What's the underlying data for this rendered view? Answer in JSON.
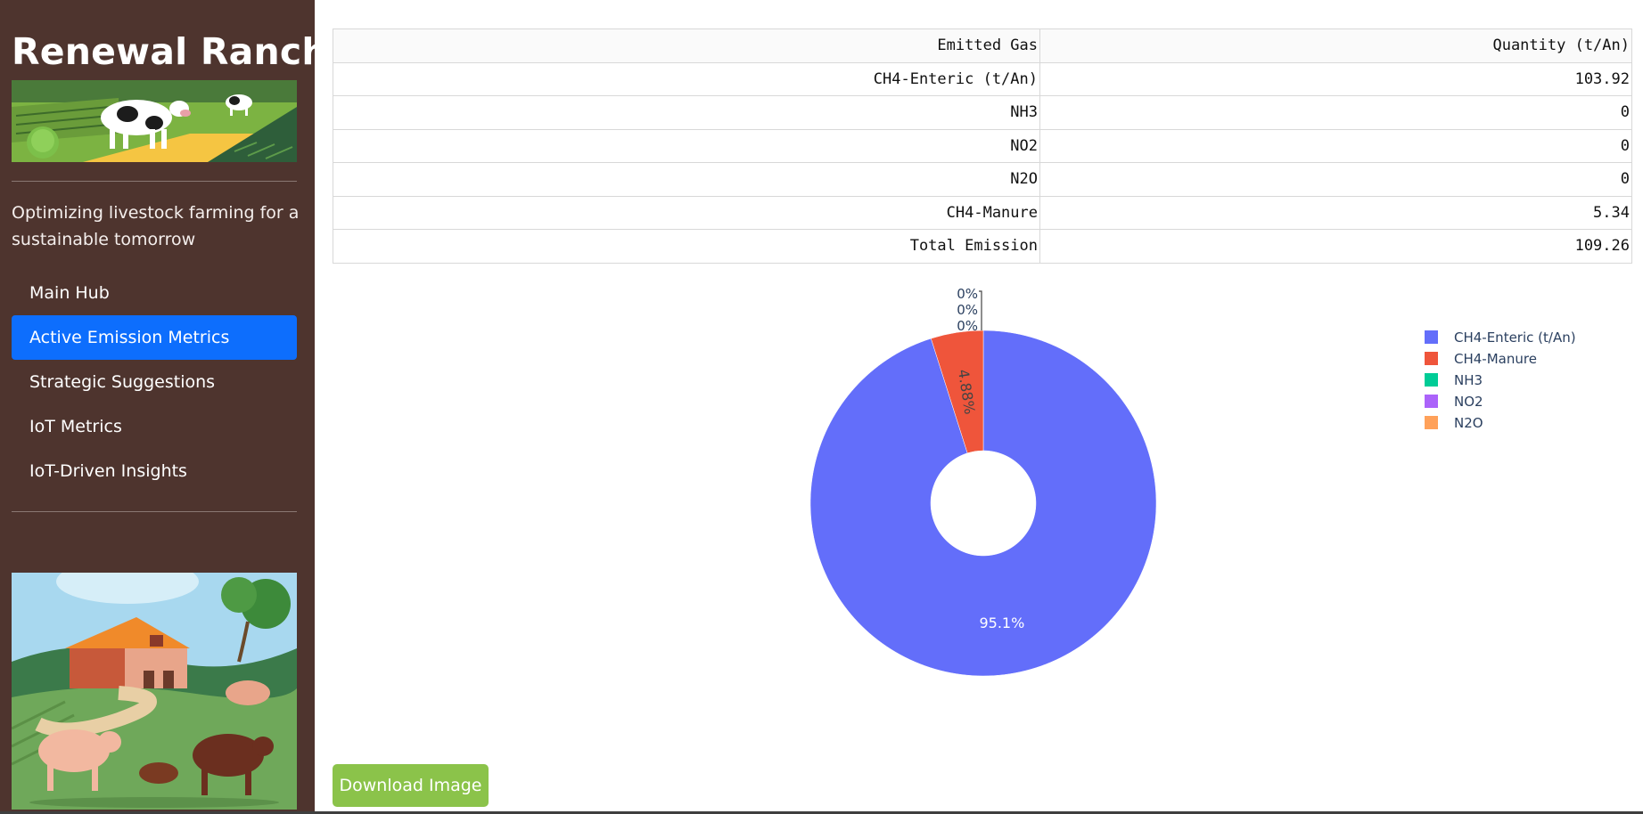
{
  "sidebar": {
    "brand": "Renewal Ranch",
    "tagline": "Optimizing livestock farming for a sustainable tomorrow",
    "nav": [
      {
        "label": "Main Hub",
        "active": false
      },
      {
        "label": "Active Emission Metrics",
        "active": true
      },
      {
        "label": "Strategic Suggestions",
        "active": false
      },
      {
        "label": "IoT Metrics",
        "active": false
      },
      {
        "label": "IoT-Driven Insights",
        "active": false
      }
    ]
  },
  "table": {
    "headers": [
      "Emitted Gas",
      "Quantity (t/An)"
    ],
    "rows": [
      [
        "CH4-Enteric (t/An)",
        "103.92"
      ],
      [
        "NH3",
        "0"
      ],
      [
        "NO2",
        "0"
      ],
      [
        "N2O",
        "0"
      ],
      [
        "CH4-Manure",
        "5.34"
      ],
      [
        "Total Emission",
        "109.26"
      ]
    ]
  },
  "chart_data": {
    "type": "pie",
    "hole": true,
    "labels": [
      "CH4-Enteric (t/An)",
      "CH4-Manure",
      "NH3",
      "NO2",
      "N2O"
    ],
    "values": [
      103.92,
      5.34,
      0,
      0,
      0
    ],
    "slice_labels": [
      "95.1%",
      "4.88%",
      "0%",
      "0%",
      "0%"
    ],
    "colors": [
      "#636efa",
      "#ef553b",
      "#00cc96",
      "#ab63fa",
      "#ffa15a"
    ],
    "legend_position": "top-right"
  },
  "download": {
    "label": "Download Image"
  },
  "colors": {
    "sidebar_bg": "#4e342e",
    "nav_active": "#0d6efd",
    "button": "#8bc34a"
  }
}
